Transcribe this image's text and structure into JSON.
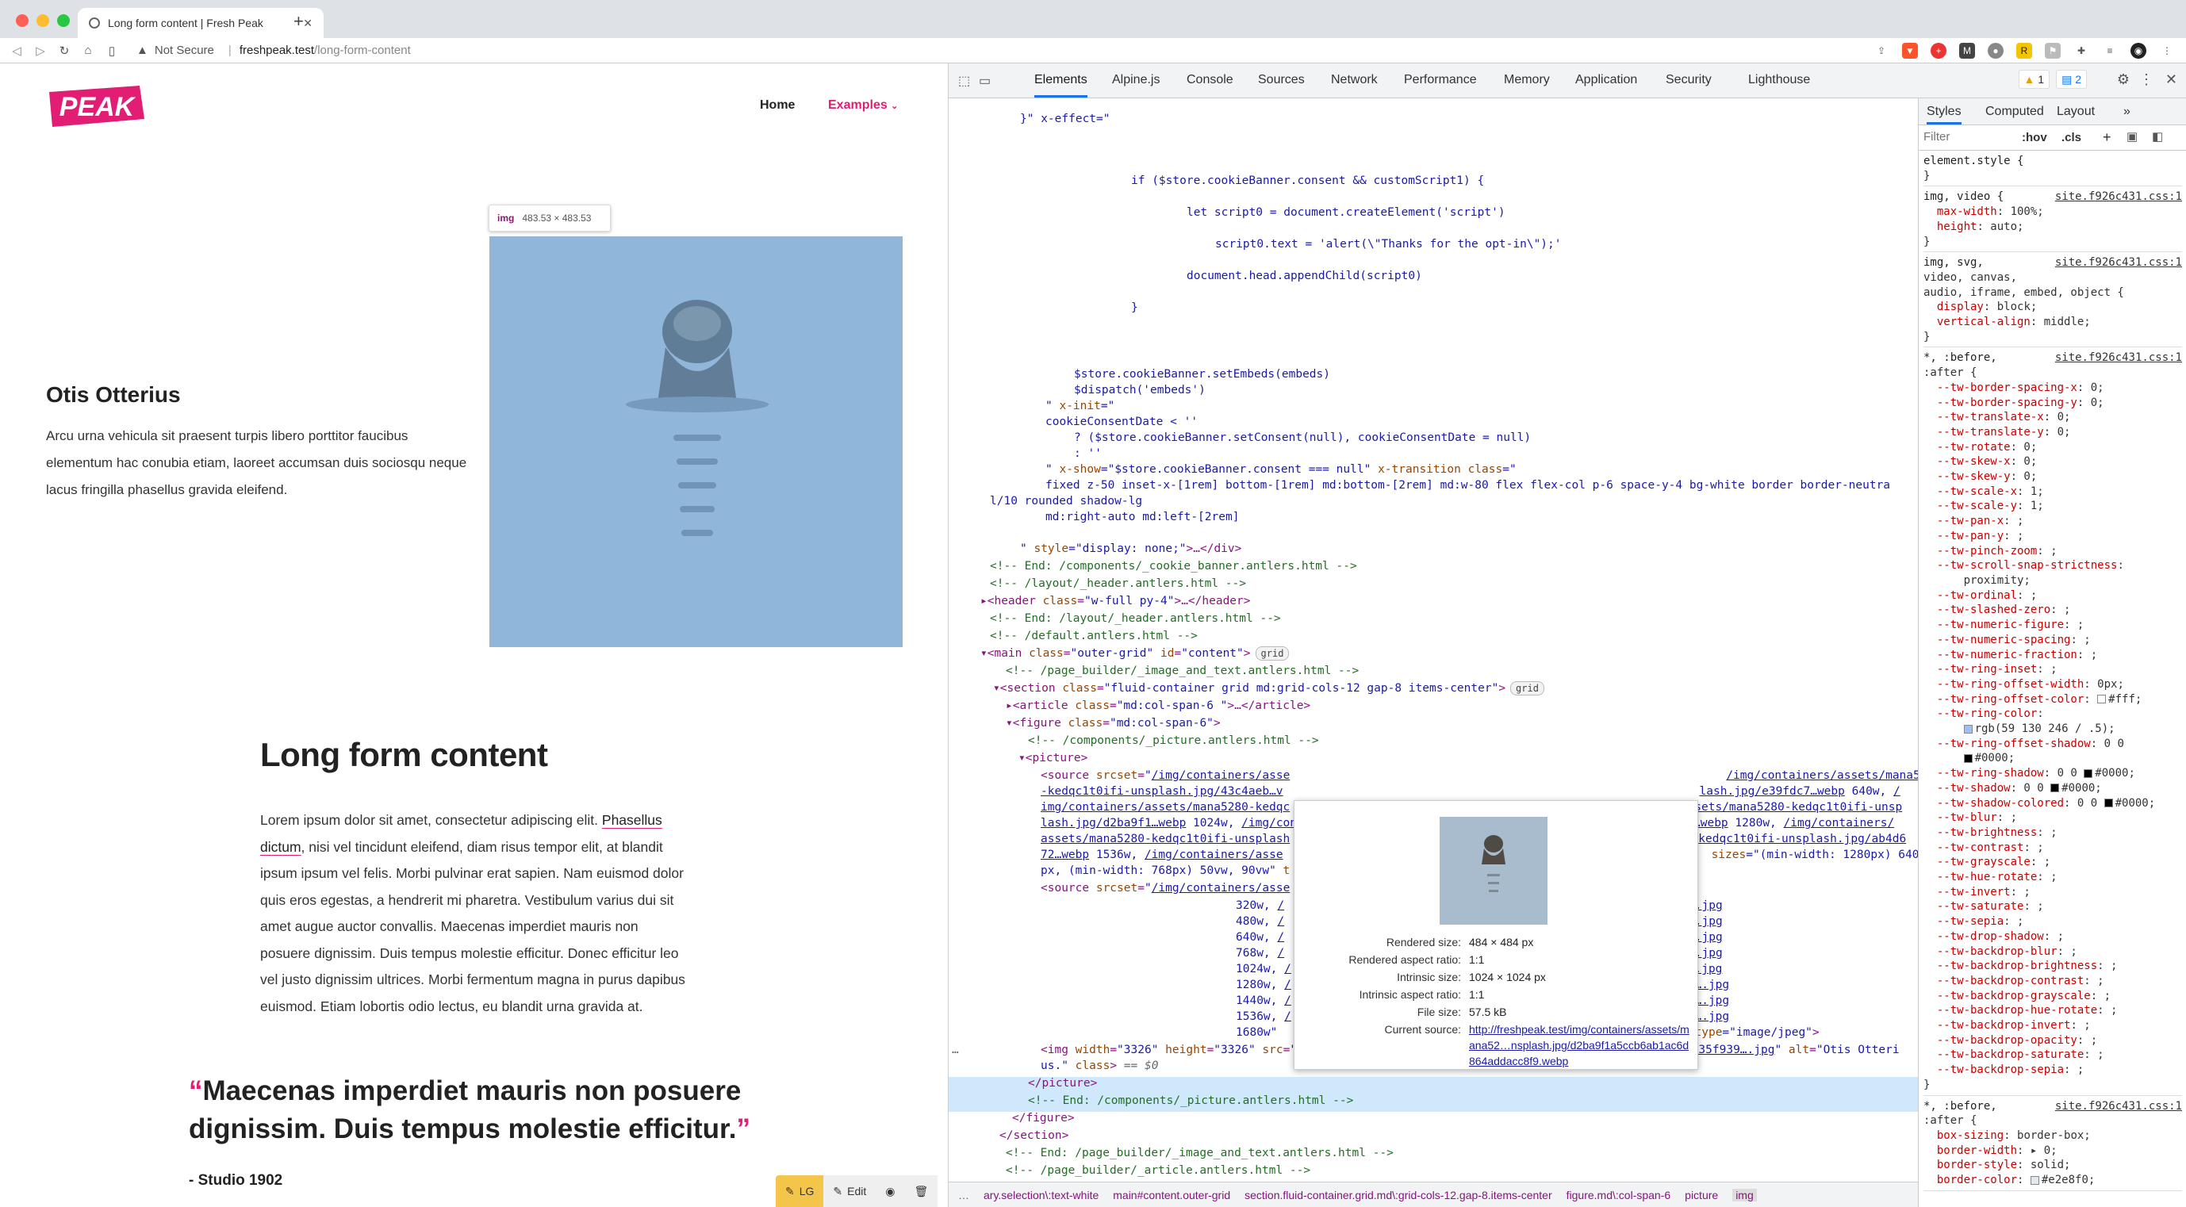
{
  "browser": {
    "tab_title": "Long form content | Fresh Peak",
    "not_secure": "Not Secure",
    "url_host": "freshpeak.test",
    "url_path": "/long-form-content"
  },
  "site": {
    "logo_text": "PEAK",
    "nav": {
      "home": "Home",
      "examples": "Examples"
    },
    "img_tooltip": {
      "tag": "img",
      "size": "483.53 × 483.53"
    },
    "hero": {
      "name": "Otis Otterius",
      "text": "Arcu urna vehicula sit praesent turpis libero porttitor faucibus elementum hac conubia etiam, laoreet accumsan duis sociosqu neque lacus fringilla phasellus gravida eleifend."
    },
    "article": {
      "title": "Long form content",
      "p1_start": "Lorem ipsum dolor sit amet, consectetur adipiscing elit.",
      "p1_link": "Phasellus dictum",
      "p1_rest": ", nisi vel tincidunt eleifend, diam risus tempor elit, at blandit ipsum ipsum vel felis. Morbi pulvinar erat sapien. Nam euismod dolor quis eros egestas, a hendrerit mi pharetra. Vestibulum varius dui sit amet augue auctor convallis. Maecenas imperdiet mauris non posuere dignissim. Duis tempus molestie efficitur. Donec efficitur leo vel justo dignissim ultrices. Morbi fermentum magna in purus dapibus euismod. Etiam lobortis odio lectus, eu blandit urna gravida at.",
      "quote": "Maecenas imperdiet mauris non posuere dignissim. Duis tempus molestie efficitur.",
      "cite": "- Studio 1902"
    },
    "toolbar": {
      "lg": "LG",
      "edit": "Edit"
    }
  },
  "devtools": {
    "tabs": [
      "Elements",
      "Alpine.js",
      "Console",
      "Sources",
      "Network",
      "Performance",
      "Memory",
      "Application",
      "Security",
      "Lighthouse"
    ],
    "warnings": "1",
    "issues": "2",
    "styles_tabs": [
      "Styles",
      "Computed",
      "Layout"
    ],
    "filter_placeholder": "Filter",
    "hov": ":hov",
    "cls": ".cls",
    "popup": {
      "rendered_size_k": "Rendered size:",
      "rendered_size_v": "484 × 484 px",
      "rendered_aspect_k": "Rendered aspect ratio:",
      "rendered_aspect_v": "1:1",
      "intrinsic_size_k": "Intrinsic size:",
      "intrinsic_size_v": "1024 × 1024 px",
      "intrinsic_aspect_k": "Intrinsic aspect ratio:",
      "intrinsic_aspect_v": "1:1",
      "file_size_k": "File size:",
      "file_size_v": "57.5 kB",
      "current_source_k": "Current source:",
      "current_source_v": "http://freshpeak.test/img/containers/assets/mana52…nsplash.jpg/d2ba9f1a5ccb6ab1ac6d864addacc8f9.webp"
    },
    "breadcrumbs": [
      "ary.selection\\:text-white",
      "main#content.outer-grid",
      "section.fluid-container.grid.md\\:grid-cols-12.gap-8.items-center",
      "figure.md\\:col-span-6",
      "picture",
      "img"
    ]
  }
}
